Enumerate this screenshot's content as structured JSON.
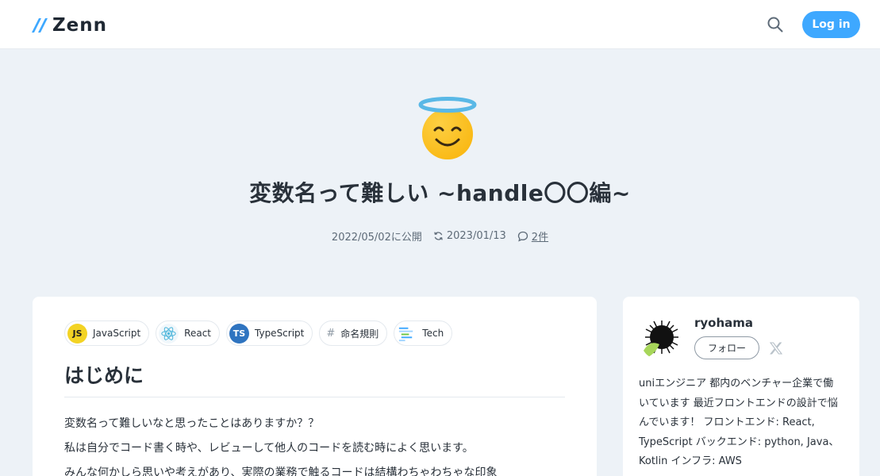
{
  "header": {
    "logo_text": "Zenn",
    "login_label": "Log in",
    "accent_color": "#3ea8ff"
  },
  "article": {
    "emoji": "smiling-face-with-halo",
    "title": "変数名って難しい ~handle〇〇編~",
    "published": "2022/05/02に公開",
    "updated": "2023/01/13",
    "comments": "2件",
    "topics": [
      {
        "label": "JavaScript",
        "icon": "javascript-icon"
      },
      {
        "label": "React",
        "icon": "react-icon"
      },
      {
        "label": "TypeScript",
        "icon": "typescript-icon"
      },
      {
        "label": "命名規則",
        "icon": "hash-icon"
      },
      {
        "label": "Tech",
        "icon": "tech-icon"
      }
    ],
    "heading": "はじめに",
    "paragraphs": [
      "変数名って難しいなと思ったことはありますか？？",
      "私は自分でコード書く時や、レビューして他人のコードを読む時によく思います。",
      "みんな何かしら思いや考えがあり、実際の業務で触るコードは結構わちゃわちゃな印象"
    ]
  },
  "author": {
    "name": "ryohama",
    "follow_label": "フォロー",
    "bio": "uniエンジニア 都内のベンチャー企業で働いています 最近フロントエンドの設計で悩んでいます！ フロントエンド: React, TypeScript バックエンド: python, Java、Kotlin インフラ: AWS"
  }
}
